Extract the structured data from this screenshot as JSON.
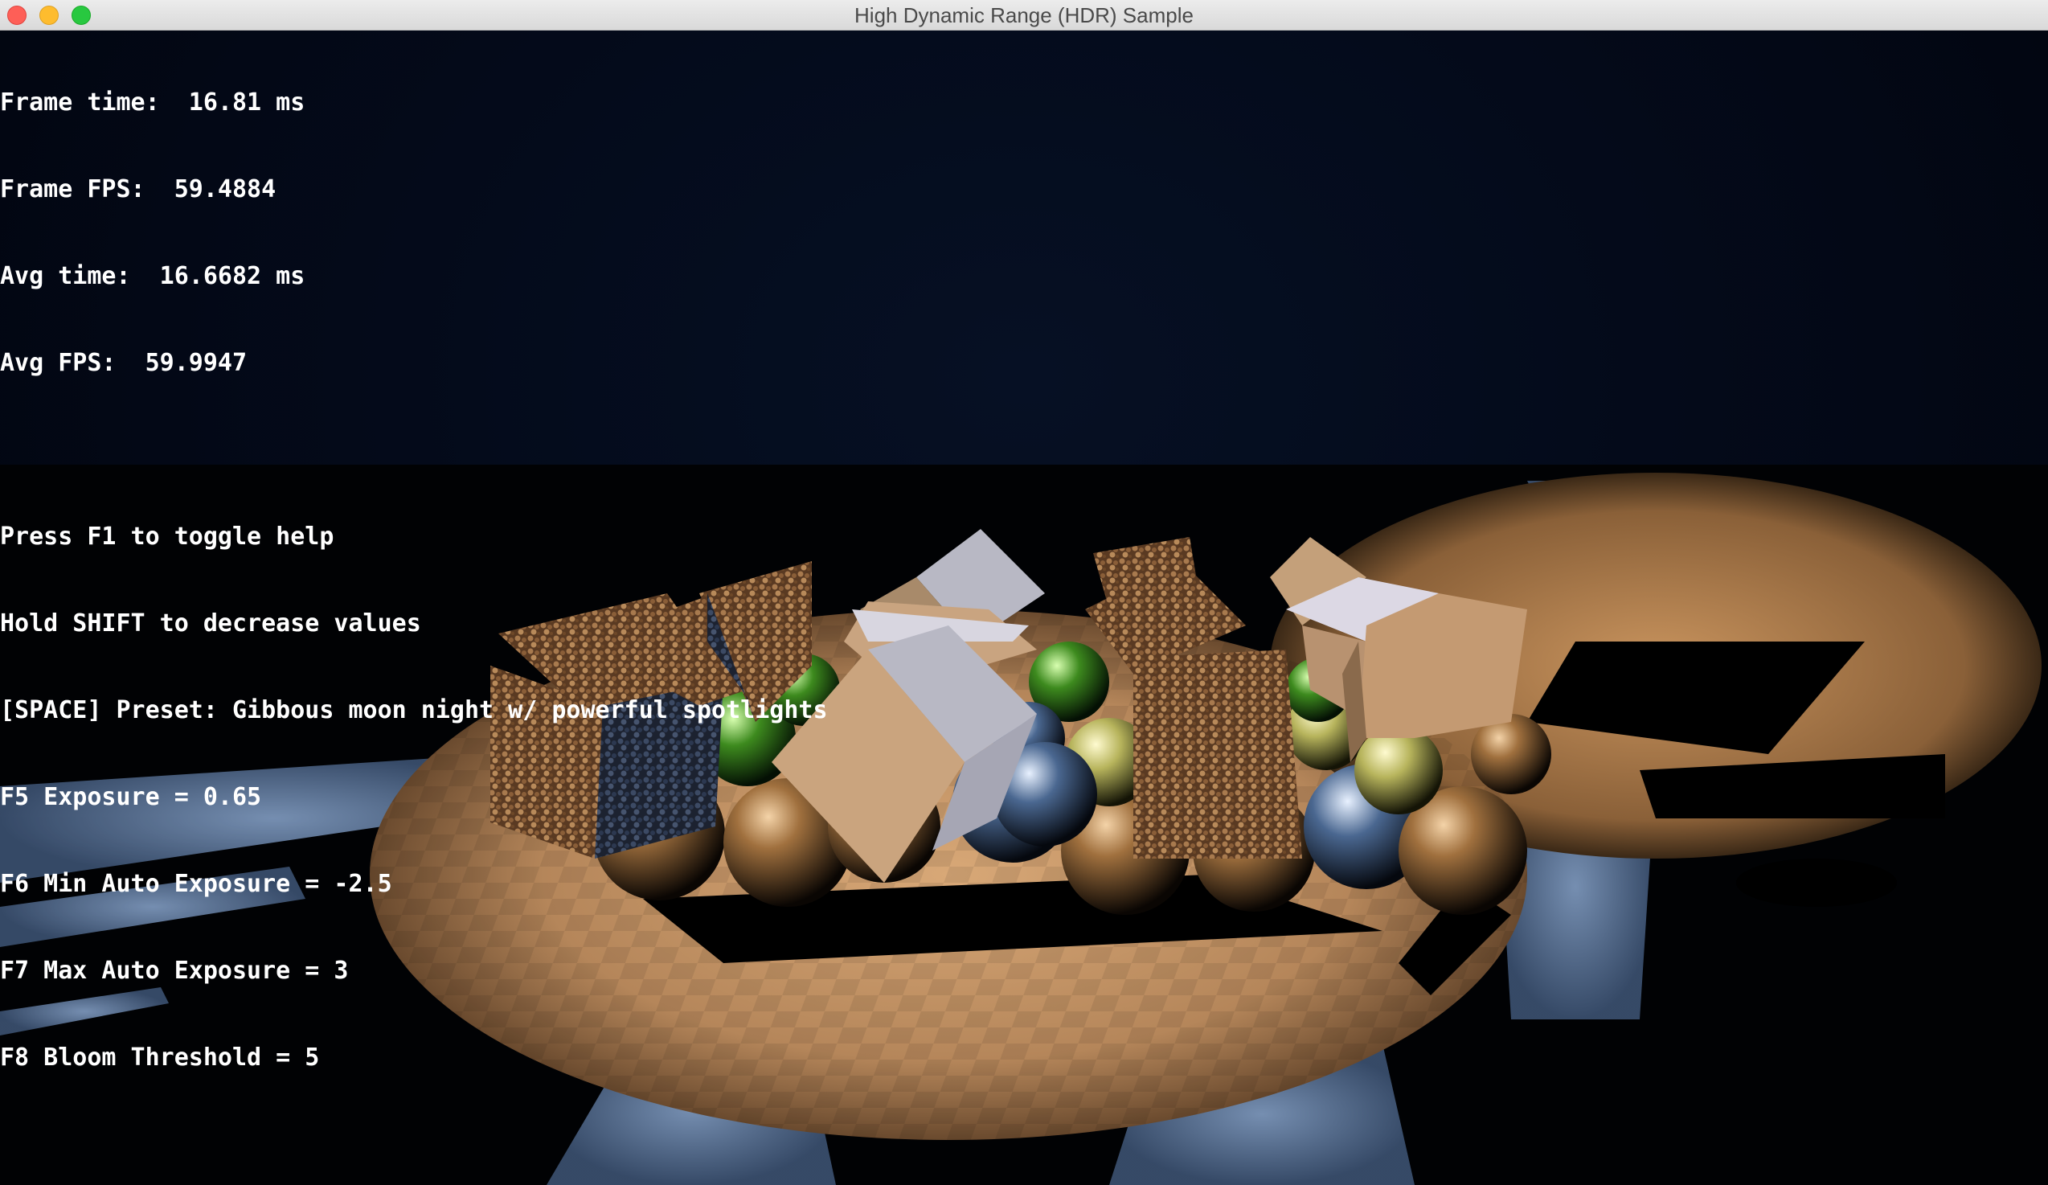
{
  "window": {
    "title": "High Dynamic Range (HDR) Sample"
  },
  "overlay": {
    "frame_time": "Frame time:  16.81 ms",
    "frame_fps": "Frame FPS:  59.4884",
    "avg_time": "Avg time:  16.6682 ms",
    "avg_fps": "Avg FPS:  59.9947",
    "help_toggle": "Press F1 to toggle help",
    "shift_hint": "Hold SHIFT to decrease values",
    "preset": "[SPACE] Preset: Gibbous moon night w/ powerful spotlights",
    "exposure": "F5 Exposure = 0.65",
    "min_auto_exposure": "F6 Min Auto Exposure = -2.5",
    "max_auto_exposure": "F7 Max Auto Exposure = 3",
    "bloom_threshold": "F8 Bloom Threshold = 5"
  },
  "colors": {
    "background": "#02050d",
    "spotlight_floor": "#c89a6a",
    "moonlit_floor": "#6e8cb8",
    "text": "#ffffff"
  }
}
